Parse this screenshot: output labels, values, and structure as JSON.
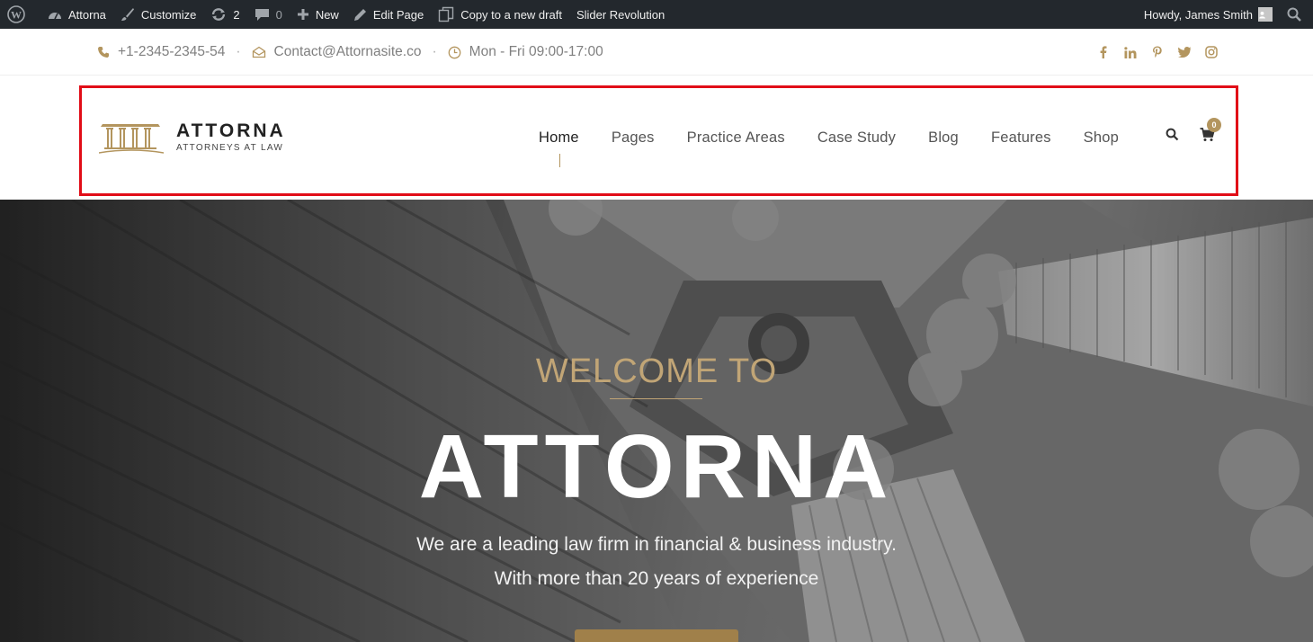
{
  "adminbar": {
    "site_name": "Attorna",
    "customize": "Customize",
    "updates_count": "2",
    "comments_count": "0",
    "new_label": "New",
    "edit_page": "Edit Page",
    "copy_draft": "Copy to a new draft",
    "slider": "Slider Revolution",
    "howdy": "Howdy, James Smith"
  },
  "topbar": {
    "phone": "+1-2345-2345-54",
    "email": "Contact@Attornasite.co",
    "hours": "Mon - Fri 09:00-17:00",
    "separator": "·",
    "socials": [
      "facebook-icon",
      "linkedin-icon",
      "pinterest-icon",
      "twitter-icon",
      "instagram-icon"
    ]
  },
  "header": {
    "logo_title": "ATTORNA",
    "logo_subtitle": "ATTORNEYS AT LAW",
    "nav": [
      "Home",
      "Pages",
      "Practice Areas",
      "Case Study",
      "Blog",
      "Features",
      "Shop"
    ],
    "active_nav": "Home",
    "cart_count": "0"
  },
  "hero": {
    "welcome": "WELCOME TO",
    "title": "ATTORNA",
    "line1": "We are a leading law firm in financial & business industry.",
    "line2": "With more than 20 years of experience"
  },
  "colors": {
    "accent": "#b3955e",
    "adminbar": "#23282d",
    "highlight": "#e10d17"
  }
}
